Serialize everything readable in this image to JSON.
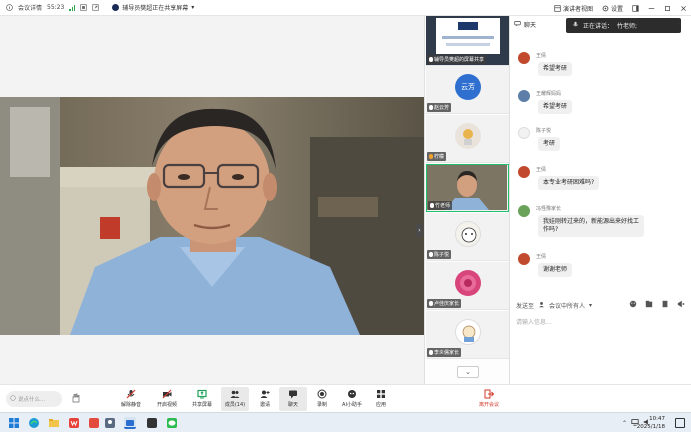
{
  "topbar": {
    "meeting_info": "会议详情",
    "elapsed": "55:23",
    "sharing_status": "辅导员樊超正在共享屏幕",
    "presenter_view": "演讲者视图",
    "settings": "设置"
  },
  "strip": {
    "tiles": [
      {
        "name": "辅导员樊超的屏幕共享"
      },
      {
        "name": "赵云芳",
        "avatar_text": "云芳",
        "avatar_color": "#2f6fd0"
      },
      {
        "name": "柠檬"
      },
      {
        "name": "竹老师"
      },
      {
        "name": "陈子悦"
      },
      {
        "name": "卢佳庆家长"
      },
      {
        "name": "李炎儒家长"
      }
    ]
  },
  "chat": {
    "title": "聊天",
    "speaking_label": "正在讲话：",
    "speaking_name": "竹老师;",
    "messages": [
      {
        "sender": "王倩",
        "text": "希望考研"
      },
      {
        "sender": "王耀辉妈妈",
        "text": "希望考研"
      },
      {
        "sender": "陈子悦",
        "text": "考研"
      },
      {
        "sender": "王倩",
        "text": "本专业考研困难吗?"
      },
      {
        "sender": "冯怪豫家长",
        "text": "我娃刚转过来的，新能源出来好找工",
        "text2": "作吗?"
      },
      {
        "sender": "王倩",
        "text": "谢谢老师"
      }
    ],
    "send_to_label": "发送至",
    "send_to_value": "会议中所有人",
    "input_placeholder": "请输入信息..."
  },
  "toolbar": {
    "say_placeholder": "说点什么...",
    "buttons": [
      {
        "label": "解除静音"
      },
      {
        "label": "开启视频"
      },
      {
        "label": "共享屏幕"
      },
      {
        "label": "成员(14)"
      },
      {
        "label": "邀请"
      },
      {
        "label": "聊天"
      },
      {
        "label": "录制"
      },
      {
        "label": "AI小助手"
      },
      {
        "label": "应用"
      }
    ],
    "leave_label": "离开会议"
  },
  "taskbar": {
    "time": "10:47",
    "date": "2025/1/18"
  }
}
